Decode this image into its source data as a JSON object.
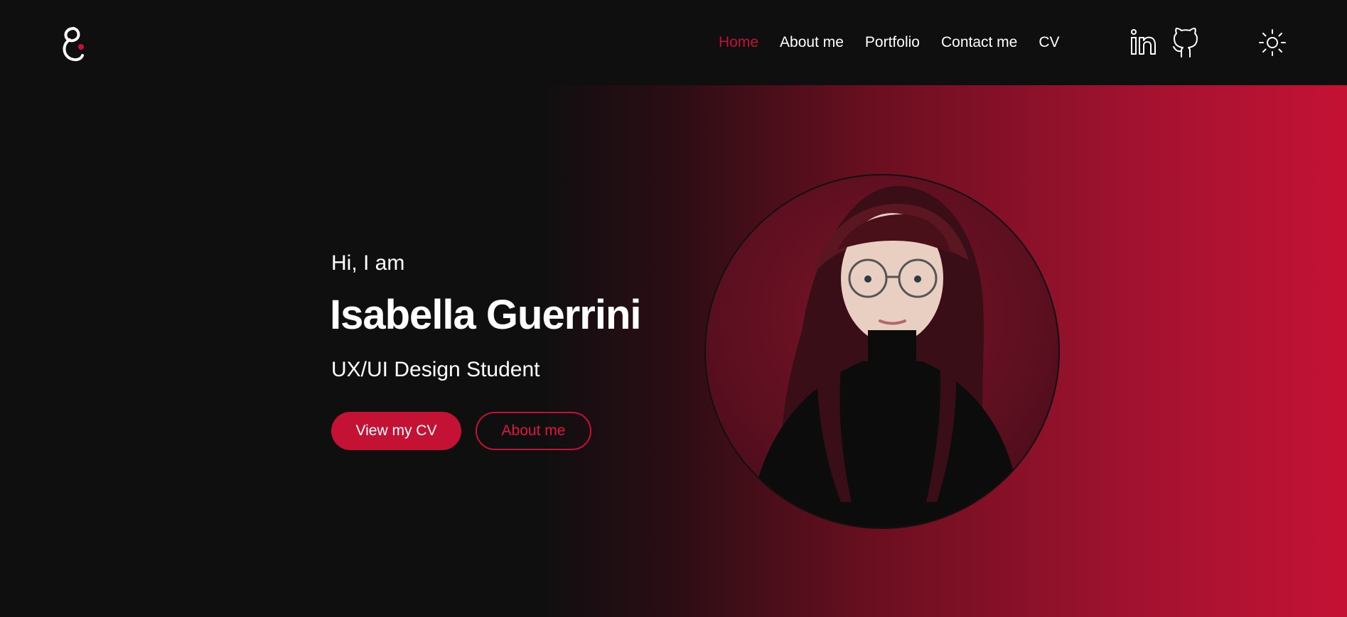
{
  "nav": {
    "items": [
      {
        "label": "Home",
        "active": true
      },
      {
        "label": "About me",
        "active": false
      },
      {
        "label": "Portfolio",
        "active": false
      },
      {
        "label": "Contact me",
        "active": false
      },
      {
        "label": "CV",
        "active": false
      }
    ]
  },
  "icons": {
    "logo": "logo-icon",
    "linkedin": "linkedin-icon",
    "github": "github-icon",
    "theme": "sun-icon"
  },
  "hero": {
    "greeting": "Hi, I am",
    "name": "Isabella Guerrini",
    "role": "UX/UI Design Student",
    "primary_button": "View my CV",
    "secondary_button": "About me"
  },
  "colors": {
    "background": "#0f0f10",
    "accent": "#c41234",
    "text": "#ffffff"
  }
}
